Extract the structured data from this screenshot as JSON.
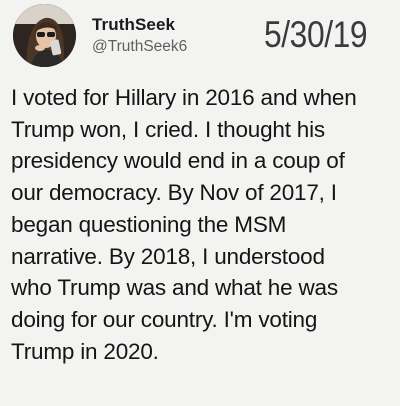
{
  "post": {
    "author": {
      "display_name": "TruthSeek",
      "handle": "@TruthSeek6"
    },
    "date_stamp": "5/30/19",
    "body_lines": [
      "I voted for Hillary in 2016 and when",
      "Trump won, I cried.  I thought his",
      "presidency would end in a coup of",
      "our democracy.  By Nov of 2017, I",
      "began questioning the MSM",
      "narrative.  By 2018, I understood",
      "who Trump was and what he was",
      "doing for our country.  I'm voting",
      "Trump in 2020."
    ]
  }
}
